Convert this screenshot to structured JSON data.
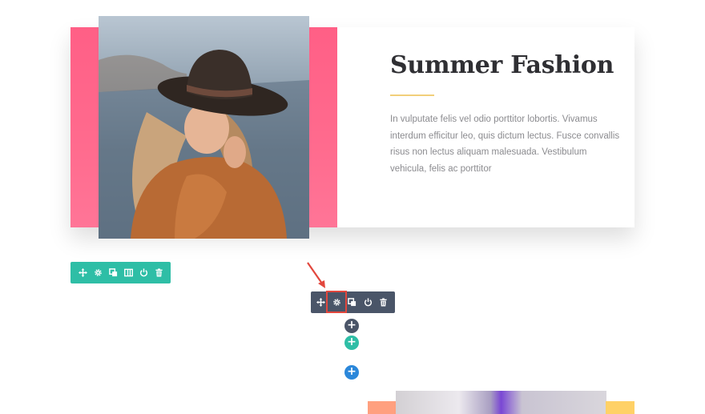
{
  "section": {
    "title": "Summer Fashion",
    "body": "In vulputate felis vel odio porttitor lobortis. Vivamus interdum efficitur leo, quis dictum lectus. Fusce convallis risus non lectus aliquam malesuada. Vestibulum vehicula, felis ac porttitor",
    "accent_color": "#f2cf7a",
    "band_color": "#ff6b8e"
  },
  "row_toolbar": {
    "color": "#2ebea6",
    "icons": [
      "move-icon",
      "gear-icon",
      "duplicate-icon",
      "columns-icon",
      "power-icon",
      "trash-icon"
    ]
  },
  "module_toolbar": {
    "color": "#4a5568",
    "icons": [
      "move-icon",
      "gear-icon",
      "duplicate-icon",
      "power-icon",
      "trash-icon"
    ],
    "highlighted": "gear-icon",
    "highlight_color": "#e2473d"
  },
  "add_buttons": [
    {
      "label": "+",
      "color": "#4a5568"
    },
    {
      "label": "+",
      "color": "#2ebea6"
    },
    {
      "label": "+",
      "color": "#2b87da"
    }
  ]
}
